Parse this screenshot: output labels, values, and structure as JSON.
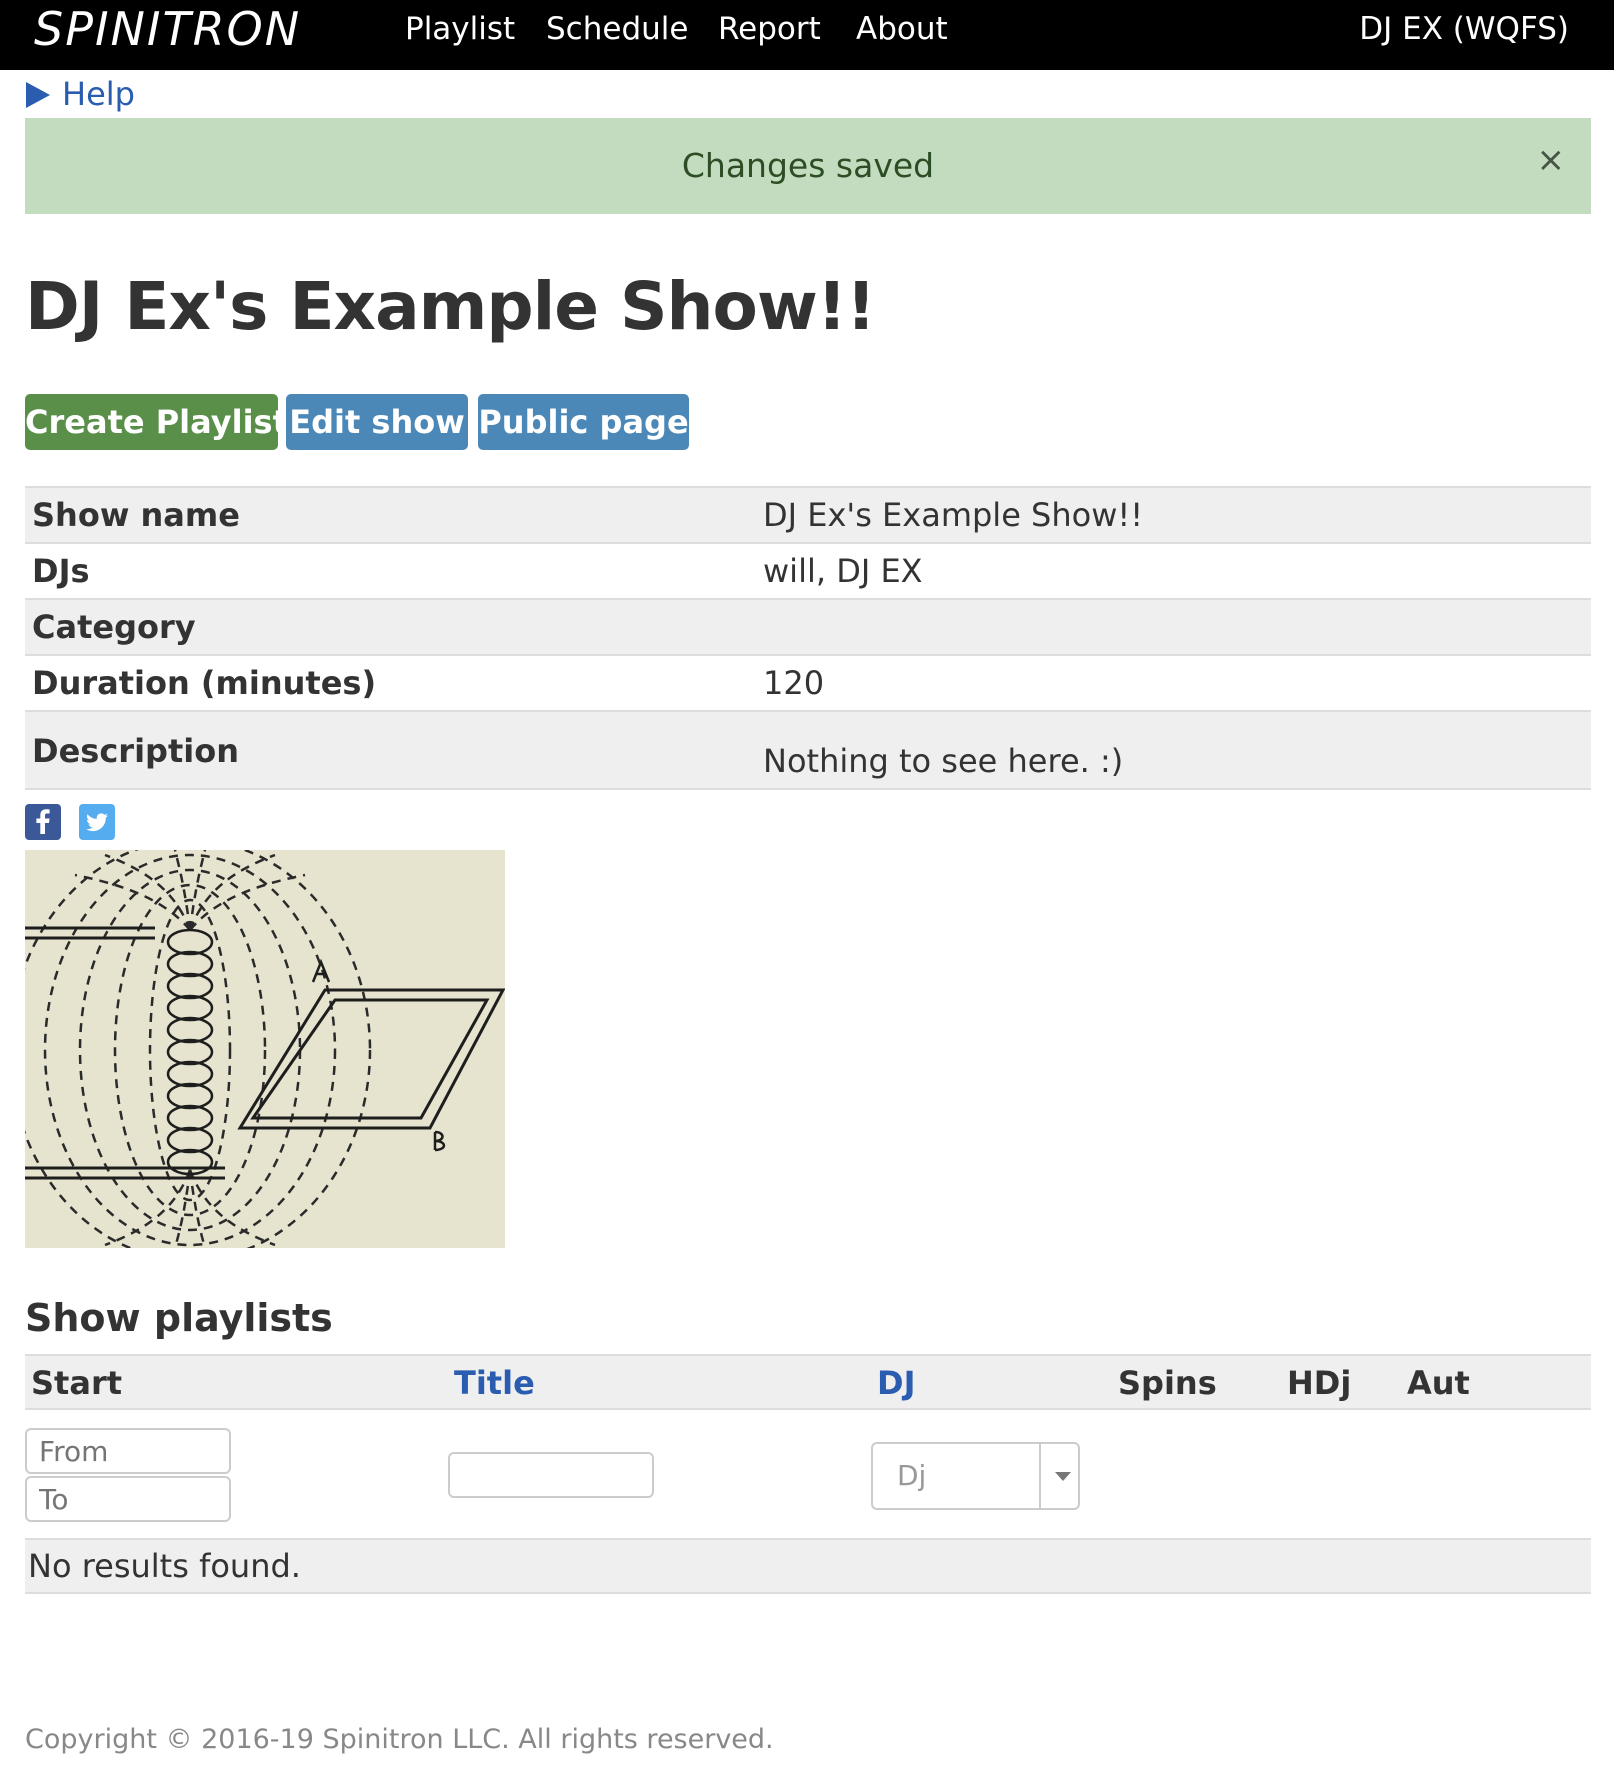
{
  "navbar": {
    "brand": "SPINITRON",
    "items": [
      {
        "label": "Playlist"
      },
      {
        "label": "Schedule"
      },
      {
        "label": "Report"
      },
      {
        "label": "About"
      }
    ],
    "user": "DJ EX (WQFS)"
  },
  "help": {
    "label": "Help"
  },
  "alert": {
    "message": "Changes saved",
    "close": "×"
  },
  "page_title": "DJ Ex's Example Show!!",
  "actions": {
    "create_playlist": "Create Playlist",
    "edit_show": "Edit show",
    "public_page": "Public page"
  },
  "show_info": [
    {
      "label": "Show name",
      "value": "DJ Ex's Example Show!!"
    },
    {
      "label": "DJs",
      "value": "will, DJ EX"
    },
    {
      "label": "Category",
      "value": ""
    },
    {
      "label": "Duration (minutes)",
      "value": "120"
    },
    {
      "label": "Description",
      "value": "Nothing to see here. :)"
    }
  ],
  "social": {
    "facebook": "facebook-icon",
    "twitter": "twitter-icon"
  },
  "playlists": {
    "title": "Show playlists",
    "columns": [
      "Start",
      "Title",
      "DJ",
      "Spins",
      "HDj",
      "Aut"
    ],
    "filters": {
      "from_placeholder": "From",
      "to_placeholder": "To",
      "title_placeholder": "",
      "dj_placeholder": "Dj"
    },
    "empty_message": "No results found."
  },
  "footer": "Copyright © 2016-19 Spinitron LLC. All rights reserved.",
  "colors": {
    "navbar": "#000000",
    "alert_bg": "#c3dcbf",
    "btn_green": "#5a8f4a",
    "btn_blue": "#4b88b8",
    "link": "#2a5db0"
  }
}
